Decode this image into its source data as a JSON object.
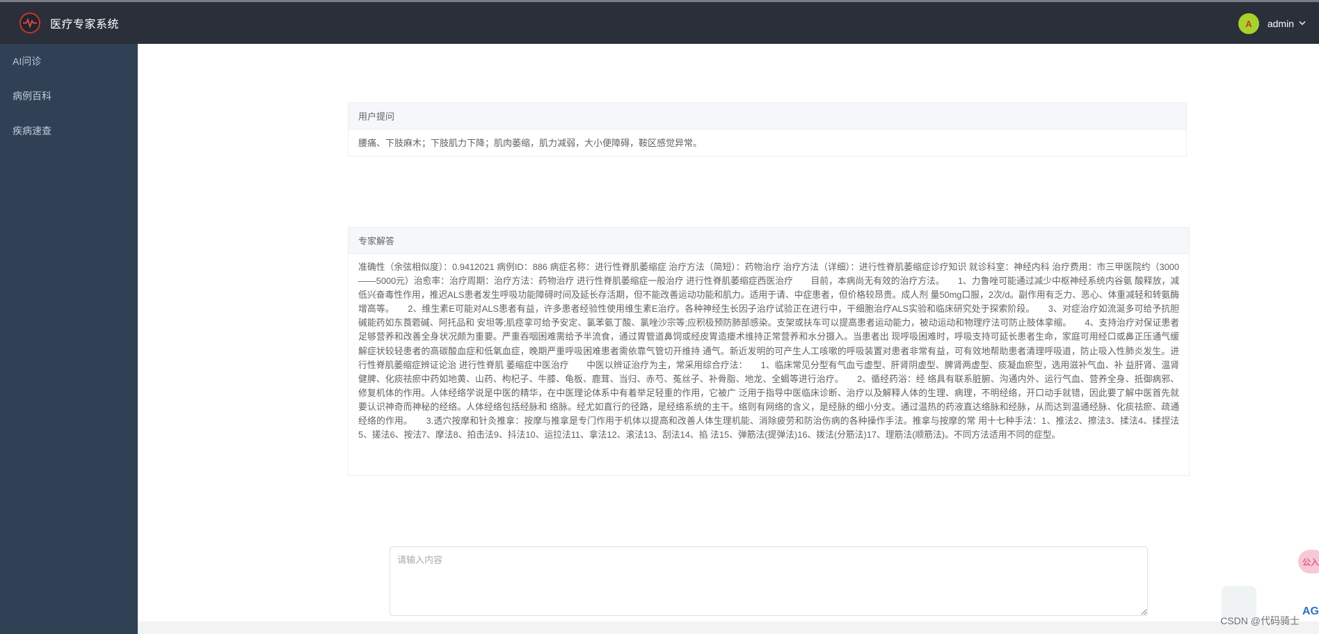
{
  "app": {
    "title": "医疗专家系统"
  },
  "sidebar": {
    "items": [
      {
        "label": "AI问诊"
      },
      {
        "label": "病例百科"
      },
      {
        "label": "疾病速查"
      }
    ]
  },
  "header": {
    "avatar_letter": "A",
    "username": "admin"
  },
  "question": {
    "header": "用户提问",
    "text": "腰痛、下肢麻木；下肢肌力下降；肌肉萎缩，肌力减弱，大小便障碍，鞍区感觉异常。"
  },
  "answer": {
    "header": "专家解答",
    "text": "准确性（余弦相似度）：0.9412021 病例ID：886 病症名称：进行性脊肌萎缩症 治疗方法（简短）：药物治疗 治疗方法（详细）：进行性脊肌萎缩症诊疗知识 就诊科室：神经内科 治疗费用：市三甲医院约（3000——5000元）治愈率：治疗周期：治疗方法：药物治疗 进行性脊肌萎缩症一般治疗 进行性脊肌萎缩症西医治疗　　目前，本病尚无有效的治疗方法。　　1、力鲁唑可能通过减少中枢神经系统内谷氨 酸释放，减低兴奋毒性作用，推迟ALS患者发生呼吸功能障碍时间及延长存活期，但不能改善运动功能和肌力。适用于请、中症患者，但价格较昂贵。成人剂 量50mg口服，2次/d。副作用有乏力、恶心、体重减轻和转氨酶增高等。　　2、维生素E可能对ALS患者有益，许多患者经验性使用维生素E治疗。各种神经生长因子治疗试验正在进行中，干细胞治疗ALS实验和临床研究处于探索阶段。　　3、对症治疗如流涎多可给予抗胆碱能药如东莨菪碱、阿托品和 安坦等;肌痉挛可给予安定、氯苯氨丁酸、氯唑沙宗等;应积极预防肺部感染。支架或扶车可以提高患者运动能力，被动运动和物理疗法可防止肢体挛缩。　　4、支持治疗对保证患者足够营养和改善全身状况颇为重要。严重吞咽困难需给予半流食，通过胃管道鼻饲或经皮胃造瘘术维持正常营养和水分摄入。当患者出 现呼吸困难时，呼吸支持可延长患者生命，家庭可用经口或鼻正压通气缓解症状较轻患者的高碳酸血症和低氧血症，晚期严重呼吸困难患者需依靠气管切开维持 通气。新近发明的可产生人工咳嗽的呼吸装置对患者非常有益，可有效地帮助患者清理呼吸道，防止吸入性肺炎发生。进行性脊肌萎缩症辨证论治 进行性脊肌 萎缩症中医治疗　　中医以辨证治疗为主，常采用综合疗法：　　1、临床常见分型有气血亏虚型、肝肾阴虚型、脾肾两虚型、痰凝血瘀型，选用滋补气血、补 益肝肾、温肾健脾、化痰祛瘀中药如地黄、山药、枸杞子、牛膝、龟板、鹿茸、当归、赤芍、菟丝子、补骨脂、地龙、全蝎等进行治疗。　　2、循经药浴：经 络具有联系脏腑、沟通内外、运行气血、营养全身、抵御病邪、修复机体的作用。人体经络学说是中医的精华，在中医理论体系中有着举足轻重的作用，它被广 泛用于指导中医临床诊断、治疗以及解释人体的生理、病理，不明经络，开口动手就错，因此要了解中医首先就要认识神奇而神秘的经络。人体经络包括经脉和 络脉。经尤如直行的径路，是经络系统的主干。络则有网络的含义，是经脉的细小分支。通过温热的药液直达络脉和经脉，从而达到温通经脉、化痰祛瘀、疏通 经络的作用。　　3.透穴按摩和针灸推拿：按摩与推拿是专门作用于机体以提高和改善人体生理机能、消除疲劳和防治伤病的各种操作手法。推拿与按摩的常 用十七种手法：1、推法2、擦法3、揉法4、揉捏法5、搓法6、按法7、摩法8、拍击法9、抖法10、运拉法11、拿法12、滚法13、刮法14、掐 法15、弹筋法(提弹法)16、拨法(分筋法)17、理筋法(顺筋法)。不同方法适用不同的症型。"
  },
  "input": {
    "placeholder": "请输入内容"
  },
  "overlay": {
    "float_tab": "公入",
    "watermark": "CSDN @代码骑士",
    "watermark_logo": "AG"
  }
}
